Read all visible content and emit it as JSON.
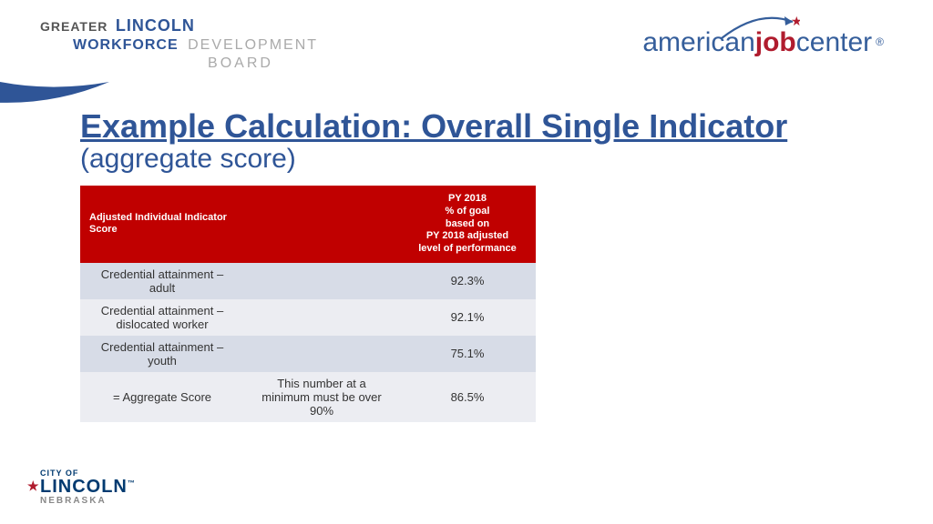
{
  "logo_left": {
    "greater": "GREATER",
    "lincoln": "LINCOLN",
    "workforce": "WORKFORCE",
    "development": "DEVELOPMENT",
    "board": "BOARD"
  },
  "logo_right": {
    "american": "american",
    "job": "job",
    "center": "center",
    "reg": "®"
  },
  "title": {
    "main": "Example Calculation: Overall Single Indicator",
    "sub": "(aggregate score)"
  },
  "table": {
    "headers": {
      "col1": "Adjusted Individual Indicator Score",
      "col2": "",
      "col3": "PY 2018\n% of goal\nbased on\nPY 2018 adjusted\nlevel of performance"
    },
    "rows": [
      {
        "label": "Credential attainment – adult",
        "note": "",
        "value": "92.3%"
      },
      {
        "label": "Credential attainment – dislocated worker",
        "note": "",
        "value": "92.1%"
      },
      {
        "label": "Credential attainment – youth",
        "note": "",
        "value": "75.1%"
      },
      {
        "label": "= Aggregate Score",
        "note": "This number at a minimum must be over 90%",
        "value": "86.5%"
      }
    ]
  },
  "city_logo": {
    "cityof": "CITY OF",
    "lincoln": "LINCOLN",
    "tm": "™",
    "nebraska": "NEBRASKA",
    "star": "★"
  },
  "chart_data": {
    "type": "table",
    "title": "Example Calculation: Overall Single Indicator (aggregate score)",
    "columns": [
      "Adjusted Individual Indicator Score",
      "",
      "PY 2018 % of goal based on PY 2018 adjusted level of performance"
    ],
    "rows": [
      [
        "Credential attainment – adult",
        "",
        92.3
      ],
      [
        "Credential attainment – dislocated worker",
        "",
        92.1
      ],
      [
        "Credential attainment – youth",
        "",
        75.1
      ],
      [
        "= Aggregate Score",
        "This number at a minimum must be over 90%",
        86.5
      ]
    ]
  }
}
